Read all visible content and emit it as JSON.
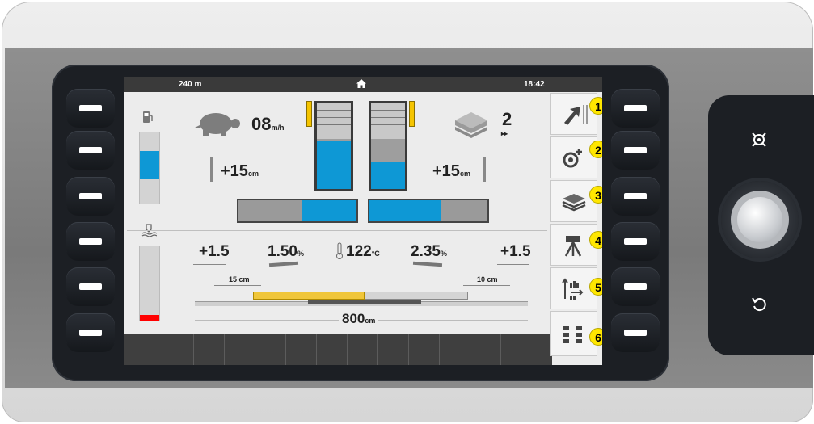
{
  "topbar": {
    "distance": "240 m",
    "time": "18:42",
    "home_icon": "home-icon"
  },
  "levels": {
    "fuel_icon": "fuel-pump-icon",
    "fuel_level_pct": 40,
    "tank_icon": "water-tank-icon",
    "tank_level_pct": 8
  },
  "speed": {
    "value": "08",
    "unit": "m/h",
    "icon": "turtle-icon"
  },
  "layers": {
    "value": "2",
    "sub": "▸▸",
    "icon": "layers-icon"
  },
  "auger": {
    "left_value": "+15",
    "left_unit": "cm",
    "right_value": "+15",
    "right_unit": "cm"
  },
  "hoppers": {
    "left_fill_pct": 57,
    "right_fill_pct": 32,
    "left_conveyor_pct": 46,
    "right_conveyor_pct": 60
  },
  "screed": {
    "left_height": "+1.5",
    "left_slope": "1.50",
    "left_slope_unit": "%",
    "temperature": "122",
    "temperature_unit": "°C",
    "right_slope": "2.35",
    "right_slope_unit": "%",
    "right_height": "+1.5",
    "left_ext": "15 cm",
    "right_ext": "10 cm",
    "width": "800",
    "width_unit": "cm"
  },
  "sidekeys": [
    {
      "num": "1",
      "icon": "exit-arrow-icon"
    },
    {
      "num": "2",
      "icon": "settings-add-icon"
    },
    {
      "num": "3",
      "icon": "layers-icon"
    },
    {
      "num": "4",
      "icon": "tripod-camera-icon"
    },
    {
      "num": "5",
      "icon": "sort-list-icon"
    },
    {
      "num": "6",
      "icon": "menu-grid-icon"
    }
  ],
  "knob": {
    "top_icon": "target-icon",
    "bottom_icon": "back-arrow-icon"
  },
  "colors": {
    "accent": "#0e98d5",
    "warning": "#f5c400",
    "badge": "#ffe600",
    "alarm": "#ff0000"
  }
}
